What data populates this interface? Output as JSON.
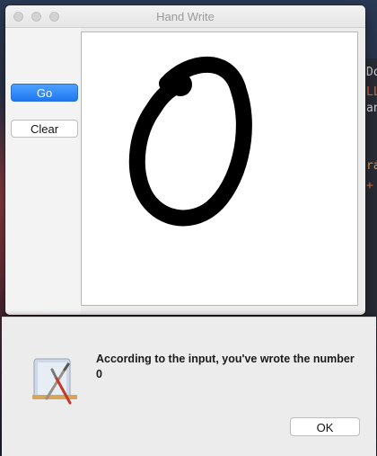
{
  "window": {
    "title": "Hand Write"
  },
  "sidebar": {
    "go_label": "Go",
    "clear_label": "Clear"
  },
  "canvas": {
    "drawn_digit": "0"
  },
  "dialog": {
    "message": "According to the input, you've wrote the number 0",
    "ok_label": "OK",
    "icon": "app-installer-icon"
  },
  "background": {
    "code_fragments": [
      "Do",
      "LL",
      "an",
      "ra",
      "+"
    ]
  }
}
